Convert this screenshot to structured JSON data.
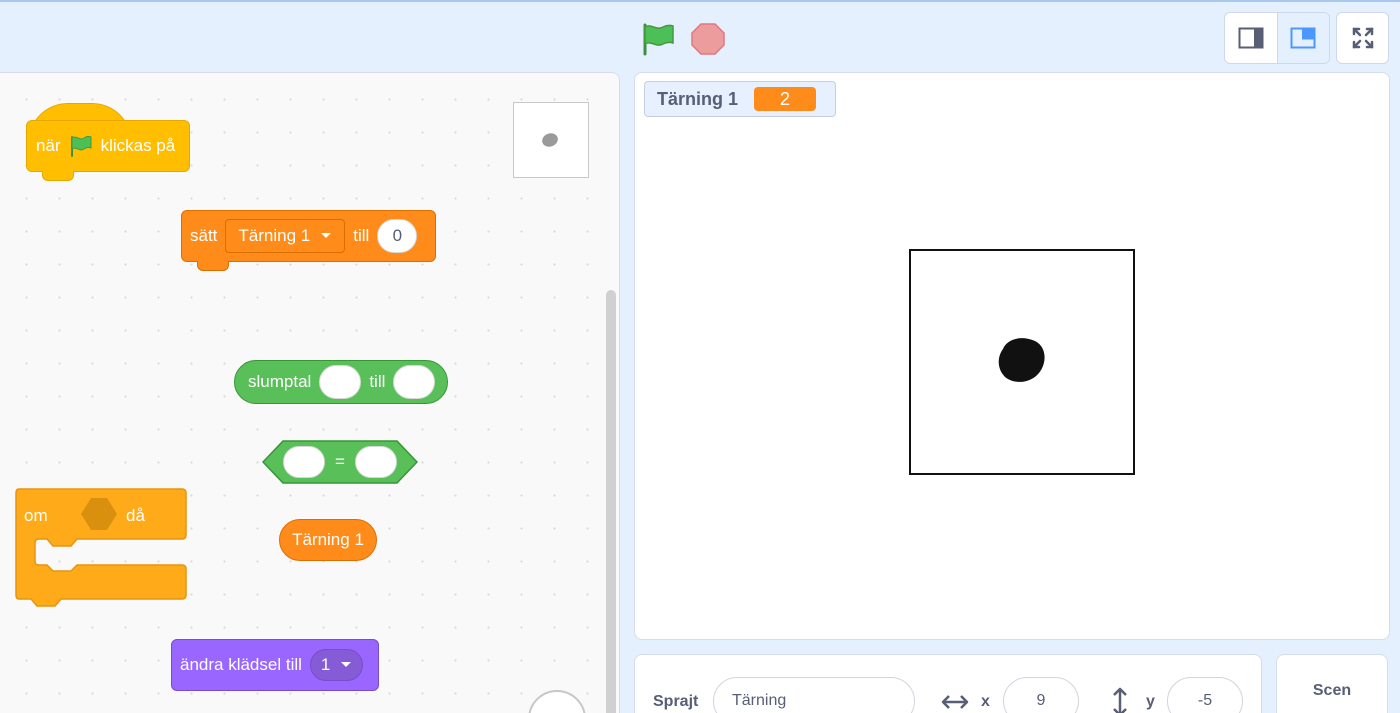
{
  "toolbar": {
    "green_flag_icon": "green-flag-icon",
    "stop_icon": "stop-icon",
    "small_stage_icon": "small-stage-icon",
    "normal_stage_icon": "normal-stage-icon",
    "fullscreen_icon": "fullscreen-icon"
  },
  "blocks": {
    "when_flag": {
      "prefix": "när",
      "suffix": "klickas på"
    },
    "set_var": {
      "label": "sätt",
      "variable": "Tärning 1",
      "to": "till",
      "value": "0"
    },
    "random": {
      "label": "slumptal",
      "to": "till",
      "from_value": "",
      "to_value": ""
    },
    "equals": {
      "op": "=",
      "left": "",
      "right": ""
    },
    "variable_reporter": {
      "label": "Tärning 1"
    },
    "if_then": {
      "if": "om",
      "then": "då"
    },
    "switch_costume": {
      "label": "ändra klädsel till",
      "value": "1"
    }
  },
  "stage": {
    "monitor": {
      "label": "Tärning 1",
      "value": "2"
    }
  },
  "sprite_info": {
    "sprite_label": "Sprajt",
    "sprite_name": "Tärning",
    "x_label": "x",
    "x_value": "9",
    "y_label": "y",
    "y_value": "-5"
  },
  "stage_panel": {
    "label": "Scen"
  },
  "colors": {
    "events": "#ffbf00",
    "variables": "#ff8c1a",
    "operators": "#59c059",
    "control": "#ffab19",
    "looks": "#9966ff",
    "accent": "#4c97ff"
  }
}
